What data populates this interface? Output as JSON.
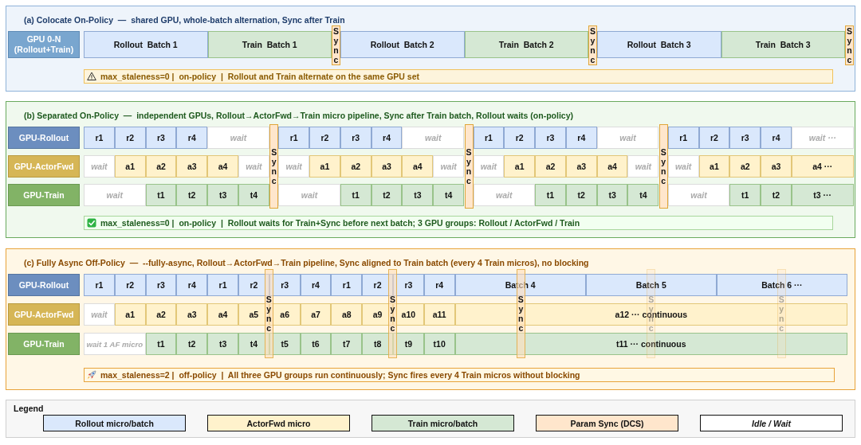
{
  "sections": [
    {
      "kind": "colocate",
      "title": "(a) Colocate On-Policy  —  shared GPU, whole-batch alternation, Sync after Train",
      "lanes": [
        {
          "label": "GPU 0-N (Rollout+Train)",
          "kind": "shared",
          "segments": [
            [
              {
                "text": "Rollout  Batch 1",
                "kind": "rollout"
              },
              {
                "text": "Train  Batch 1",
                "kind": "train"
              }
            ],
            [
              {
                "text": "Rollout  Batch 2",
                "kind": "rollout"
              },
              {
                "text": "Train  Batch 2",
                "kind": "train"
              }
            ],
            [
              {
                "text": "Rollout  Batch 3",
                "kind": "rollout"
              },
              {
                "text": "Train  Batch 3",
                "kind": "train"
              }
            ]
          ]
        }
      ],
      "syncs": [
        {
          "label": "Sync",
          "faded": false
        },
        {
          "label": "Sync",
          "faded": false
        },
        {
          "label": "Sync",
          "faded": false
        }
      ],
      "note": {
        "kind": "caution",
        "text": "max_staleness=0 |  on-policy  |  Rollout and Train alternate on the same GPU set"
      }
    },
    {
      "kind": "separated",
      "title": "(b) Separated On-Policy  —  independent GPUs, Rollout→ActorFwd→Train micro pipeline, Sync after Train batch, Rollout waits (on-policy)",
      "lanes": [
        {
          "label": "GPU-Rollout",
          "kind": "rollout",
          "segments": [
            [
              {
                "text": "r1",
                "kind": "micro"
              },
              {
                "text": "r2",
                "kind": "micro"
              },
              {
                "text": "r3",
                "kind": "micro"
              },
              {
                "text": "r4",
                "kind": "micro"
              },
              {
                "text": "wait",
                "kind": "gap"
              }
            ],
            [
              {
                "text": "r1",
                "kind": "micro"
              },
              {
                "text": "r2",
                "kind": "micro"
              },
              {
                "text": "r3",
                "kind": "micro"
              },
              {
                "text": "r4",
                "kind": "micro"
              },
              {
                "text": "wait",
                "kind": "gap"
              }
            ],
            [
              {
                "text": "r1",
                "kind": "micro"
              },
              {
                "text": "r2",
                "kind": "micro"
              },
              {
                "text": "r3",
                "kind": "micro"
              },
              {
                "text": "r4",
                "kind": "micro"
              },
              {
                "text": "wait",
                "kind": "gap"
              }
            ],
            [
              {
                "text": "r1",
                "kind": "micro"
              },
              {
                "text": "r2",
                "kind": "micro"
              },
              {
                "text": "r3",
                "kind": "micro"
              },
              {
                "text": "r4",
                "kind": "micro"
              },
              {
                "text": "wait ···",
                "kind": "gap"
              }
            ]
          ]
        },
        {
          "label": "GPU-ActorFwd",
          "kind": "actor",
          "segments": [
            [
              {
                "text": "wait",
                "kind": "idle"
              },
              {
                "text": "a1",
                "kind": "micro"
              },
              {
                "text": "a2",
                "kind": "micro"
              },
              {
                "text": "a3",
                "kind": "micro"
              },
              {
                "text": "a4",
                "kind": "micro"
              },
              {
                "text": "wait",
                "kind": "idle"
              }
            ],
            [
              {
                "text": "wait",
                "kind": "idle"
              },
              {
                "text": "a1",
                "kind": "micro"
              },
              {
                "text": "a2",
                "kind": "micro"
              },
              {
                "text": "a3",
                "kind": "micro"
              },
              {
                "text": "a4",
                "kind": "micro"
              },
              {
                "text": "wait",
                "kind": "idle"
              }
            ],
            [
              {
                "text": "wait",
                "kind": "idle"
              },
              {
                "text": "a1",
                "kind": "micro"
              },
              {
                "text": "a2",
                "kind": "micro"
              },
              {
                "text": "a3",
                "kind": "micro"
              },
              {
                "text": "a4",
                "kind": "micro"
              },
              {
                "text": "wait",
                "kind": "idle"
              }
            ],
            [
              {
                "text": "wait",
                "kind": "idle"
              },
              {
                "text": "a1",
                "kind": "micro"
              },
              {
                "text": "a2",
                "kind": "micro"
              },
              {
                "text": "a3",
                "kind": "micro"
              },
              {
                "text": "a4 ···",
                "kind": "tail"
              }
            ]
          ]
        },
        {
          "label": "GPU-Train",
          "kind": "train",
          "segments": [
            [
              {
                "text": "wait",
                "kind": "gap"
              },
              {
                "text": "t1",
                "kind": "micro"
              },
              {
                "text": "t2",
                "kind": "micro"
              },
              {
                "text": "t3",
                "kind": "micro"
              },
              {
                "text": "t4",
                "kind": "micro"
              }
            ],
            [
              {
                "text": "wait",
                "kind": "gap"
              },
              {
                "text": "t1",
                "kind": "micro"
              },
              {
                "text": "t2",
                "kind": "micro"
              },
              {
                "text": "t3",
                "kind": "micro"
              },
              {
                "text": "t4",
                "kind": "micro"
              }
            ],
            [
              {
                "text": "wait",
                "kind": "gap"
              },
              {
                "text": "t1",
                "kind": "micro"
              },
              {
                "text": "t2",
                "kind": "micro"
              },
              {
                "text": "t3",
                "kind": "micro"
              },
              {
                "text": "t4",
                "kind": "micro"
              }
            ],
            [
              {
                "text": "wait",
                "kind": "gap"
              },
              {
                "text": "t1",
                "kind": "micro"
              },
              {
                "text": "t2",
                "kind": "micro"
              },
              {
                "text": "t3 ···",
                "kind": "tail"
              }
            ]
          ]
        }
      ],
      "syncs": [
        {
          "label": "Sync",
          "faded": false
        },
        {
          "label": "Sync",
          "faded": false
        },
        {
          "label": "Sync",
          "faded": false
        }
      ],
      "note": {
        "kind": "pass",
        "text": "max_staleness=0 |  on-policy  |  Rollout waits for Train+Sync before next batch; 3 GPU groups: Rollout / ActorFwd / Train"
      }
    },
    {
      "kind": "async",
      "title": "(c) Fully Async Off-Policy  —  --fully-async, Rollout→ActorFwd→Train pipeline, Sync aligned to Train batch (every 4 Train micros), no blocking",
      "lanes": [
        {
          "label": "GPU-Rollout",
          "kind": "rollout",
          "segments": [
            [
              {
                "text": "r1",
                "kind": "micro"
              },
              {
                "text": "r2",
                "kind": "micro"
              },
              {
                "text": "r3",
                "kind": "micro"
              },
              {
                "text": "r4",
                "kind": "micro"
              },
              {
                "text": "r1",
                "kind": "micro"
              },
              {
                "text": "r2",
                "kind": "micro"
              },
              {
                "text": "r3",
                "kind": "micro"
              },
              {
                "text": "r4",
                "kind": "micro"
              },
              {
                "text": "r1",
                "kind": "micro"
              },
              {
                "text": "r2",
                "kind": "micro"
              },
              {
                "text": "r3",
                "kind": "micro"
              },
              {
                "text": "r4",
                "kind": "micro"
              },
              {
                "text": "Batch 4",
                "kind": "batch"
              },
              {
                "text": "Batch 5",
                "kind": "batch"
              },
              {
                "text": "Batch 6 ···",
                "kind": "batch"
              }
            ]
          ]
        },
        {
          "label": "GPU-ActorFwd",
          "kind": "actor",
          "segments": [
            [
              {
                "text": "wait",
                "kind": "idle"
              },
              {
                "text": "a1",
                "kind": "micro"
              },
              {
                "text": "a2",
                "kind": "micro"
              },
              {
                "text": "a3",
                "kind": "micro"
              },
              {
                "text": "a4",
                "kind": "micro"
              },
              {
                "text": "a5",
                "kind": "micro"
              },
              {
                "text": "a6",
                "kind": "micro"
              },
              {
                "text": "a7",
                "kind": "micro"
              },
              {
                "text": "a8",
                "kind": "micro"
              },
              {
                "text": "a9",
                "kind": "micro"
              },
              {
                "text": "a10",
                "kind": "micro"
              },
              {
                "text": "a11",
                "kind": "micro"
              },
              {
                "text": "a12 ··· continuous",
                "kind": "batch"
              }
            ]
          ]
        },
        {
          "label": "GPU-Train",
          "kind": "train",
          "segments": [
            [
              {
                "text": "wait 1 AF micro",
                "kind": "gap"
              },
              {
                "text": "t1",
                "kind": "micro"
              },
              {
                "text": "t2",
                "kind": "micro"
              },
              {
                "text": "t3",
                "kind": "micro"
              },
              {
                "text": "t4",
                "kind": "micro",
                "syncs": [
                  {
                    "label": "Sync",
                    "faded": false
                  }
                ]
              },
              {
                "text": "t5",
                "kind": "micro"
              },
              {
                "text": "t6",
                "kind": "micro"
              },
              {
                "text": "t7",
                "kind": "micro"
              },
              {
                "text": "t8",
                "kind": "micro",
                "syncs": [
                  {
                    "label": "Sync",
                    "faded": false
                  }
                ]
              },
              {
                "text": "t9",
                "kind": "micro"
              },
              {
                "text": "t10",
                "kind": "micro"
              },
              {
                "text": "t11 ··· continuous",
                "kind": "batch",
                "syncs": [
                  {
                    "label": "Sync",
                    "faded": false
                  },
                  {
                    "label": "Sync",
                    "faded": true
                  },
                  {
                    "label": "Sync",
                    "faded": true
                  }
                ]
              }
            ]
          ]
        }
      ],
      "note": {
        "kind": "launch",
        "text": "max_staleness=2 |  off-policy  |  All three GPU groups run continuously; Sync fires every 4 Train micros without blocking"
      }
    }
  ],
  "legend": {
    "title": "Legend",
    "items": [
      {
        "label": "Rollout micro/batch",
        "kind": "rollout"
      },
      {
        "label": "ActorFwd micro",
        "kind": "actor"
      },
      {
        "label": "Train micro/batch",
        "kind": "train"
      },
      {
        "label": "Param Sync (DCS)",
        "kind": "sync"
      },
      {
        "label": "Idle / Wait",
        "kind": "wait"
      }
    ]
  }
}
